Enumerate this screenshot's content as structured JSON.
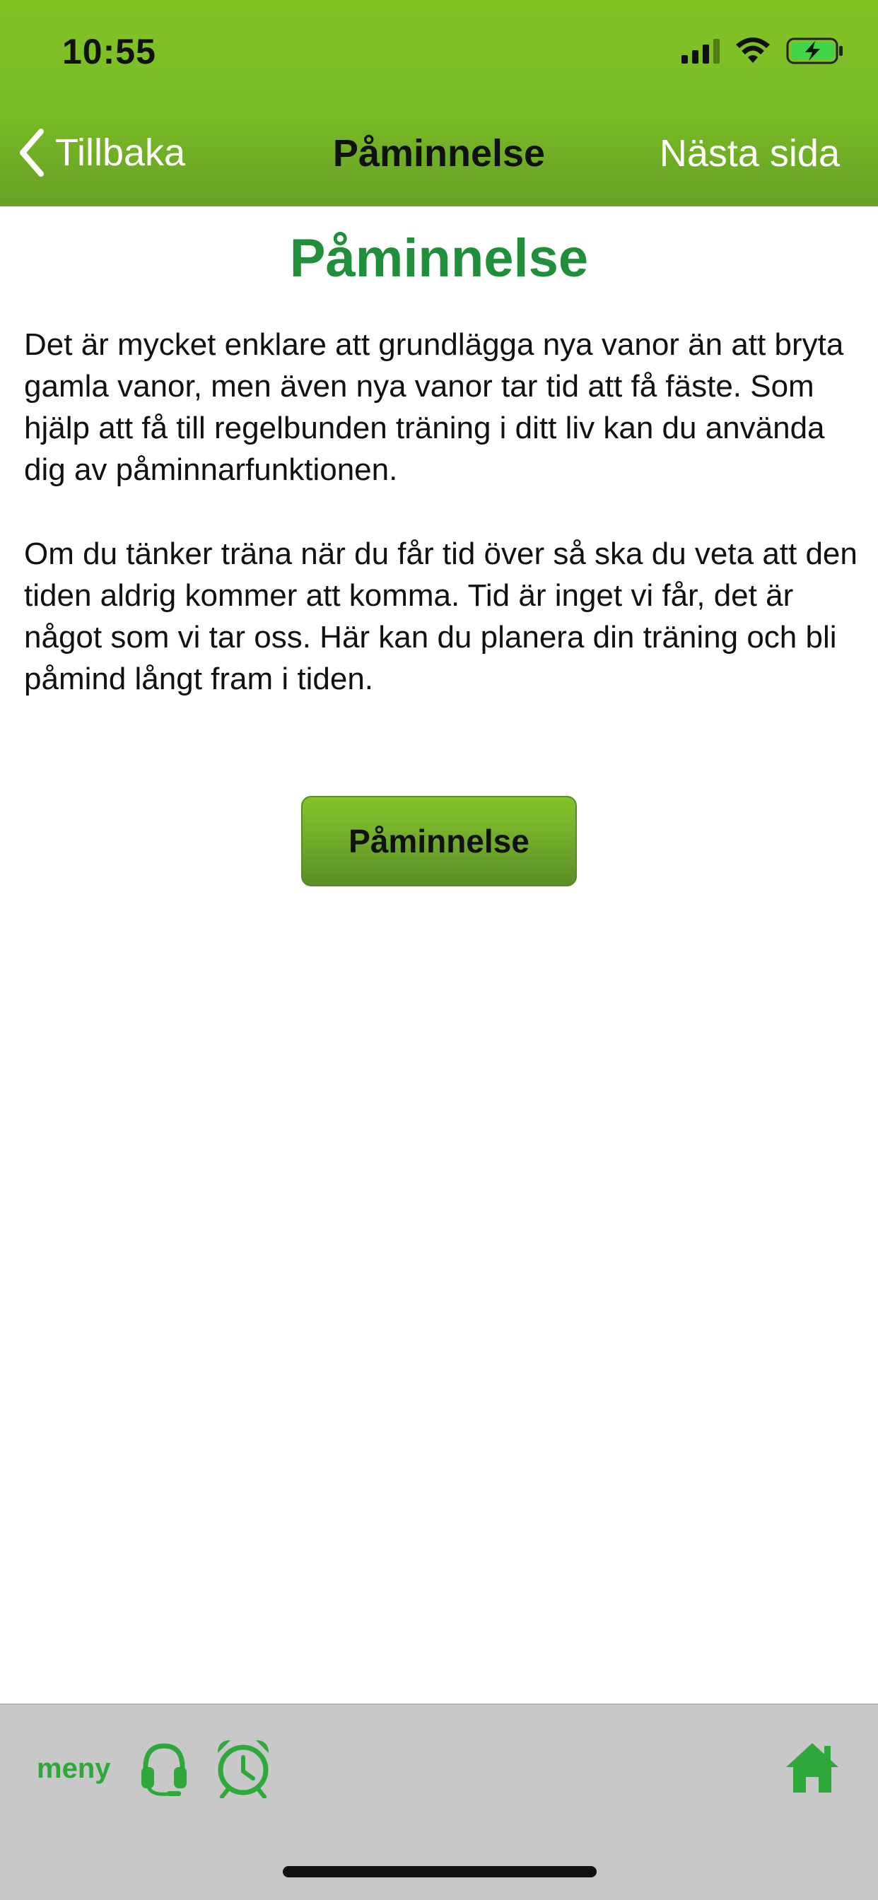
{
  "status_bar": {
    "time": "10:55"
  },
  "nav": {
    "back_label": "Tillbaka",
    "title": "Påminnelse",
    "next_label": "Nästa sida"
  },
  "content": {
    "title": "Påminnelse",
    "paragraphs": [
      "Det är mycket enklare att grundlägga nya vanor än att bryta gamla vanor, men även nya vanor tar tid att få fäste. Som hjälp att få till regelbunden träning i ditt liv kan du använda dig av påminnarfunktionen.",
      "Om du tänker träna när du får tid över så ska du veta att den tiden aldrig kommer att komma. Tid är inget vi får, det är något som vi tar oss. Här kan du planera din träning och bli påmind långt fram i tiden."
    ],
    "button_label": "Påminnelse"
  },
  "toolbar": {
    "menu_label": "meny",
    "icons": [
      "headset-icon",
      "alarm-clock-icon",
      "home-icon"
    ]
  },
  "colors": {
    "header_green": "#7cbf25",
    "title_green": "#1f8f3a",
    "toolbar_green": "#2ea83a",
    "toolbar_bg": "#c8c8c8"
  }
}
